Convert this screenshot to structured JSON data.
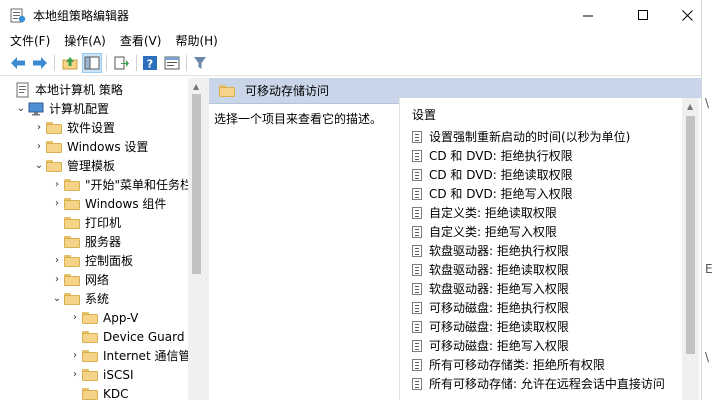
{
  "window": {
    "title": "本地组策略编辑器",
    "app_icon": "policy-editor-icon"
  },
  "menu": [
    {
      "label": "文件(F)"
    },
    {
      "label": "操作(A)"
    },
    {
      "label": "查看(V)"
    },
    {
      "label": "帮助(H)"
    }
  ],
  "toolbar": {
    "icons": [
      "back-icon",
      "forward-icon",
      "up-folder-icon",
      "show-hide-tree-icon",
      "export-list-icon",
      "help-icon",
      "properties-icon",
      "filter-icon"
    ]
  },
  "tree": [
    {
      "label": "本地计算机 策略",
      "indent": 0,
      "expander": "",
      "icon": "computer-policy-icon"
    },
    {
      "label": "计算机配置",
      "indent": 1,
      "expander": "expanded",
      "icon": "computer-icon"
    },
    {
      "label": "软件设置",
      "indent": 2,
      "expander": "collapsed",
      "icon": "folder-icon"
    },
    {
      "label": "Windows 设置",
      "indent": 2,
      "expander": "collapsed",
      "icon": "folder-icon"
    },
    {
      "label": "管理模板",
      "indent": 2,
      "expander": "expanded",
      "icon": "folder-icon"
    },
    {
      "label": "\"开始\"菜单和任务栏",
      "indent": 3,
      "expander": "collapsed",
      "icon": "folder-icon"
    },
    {
      "label": "Windows 组件",
      "indent": 3,
      "expander": "collapsed",
      "icon": "folder-icon"
    },
    {
      "label": "打印机",
      "indent": 3,
      "expander": "",
      "icon": "folder-icon"
    },
    {
      "label": "服务器",
      "indent": 3,
      "expander": "",
      "icon": "folder-icon"
    },
    {
      "label": "控制面板",
      "indent": 3,
      "expander": "collapsed",
      "icon": "folder-icon"
    },
    {
      "label": "网络",
      "indent": 3,
      "expander": "collapsed",
      "icon": "folder-icon"
    },
    {
      "label": "系统",
      "indent": 3,
      "expander": "expanded",
      "icon": "folder-icon"
    },
    {
      "label": "App-V",
      "indent": 4,
      "expander": "collapsed",
      "icon": "folder-icon"
    },
    {
      "label": "Device Guard",
      "indent": 4,
      "expander": "",
      "icon": "folder-icon"
    },
    {
      "label": "Internet 通信管理",
      "indent": 4,
      "expander": "collapsed",
      "icon": "folder-icon"
    },
    {
      "label": "iSCSI",
      "indent": 4,
      "expander": "collapsed",
      "icon": "folder-icon"
    },
    {
      "label": "KDC",
      "indent": 4,
      "expander": "",
      "icon": "folder-icon"
    }
  ],
  "details": {
    "header": "可移动存储访问",
    "description": "选择一个项目来查看它的描述。",
    "column_header": "设置",
    "settings": [
      "设置强制重新启动的时间(以秒为单位)",
      "CD 和 DVD: 拒绝执行权限",
      "CD 和 DVD: 拒绝读取权限",
      "CD 和 DVD: 拒绝写入权限",
      "自定义类: 拒绝读取权限",
      "自定义类: 拒绝写入权限",
      "软盘驱动器: 拒绝执行权限",
      "软盘驱动器: 拒绝读取权限",
      "软盘驱动器: 拒绝写入权限",
      "可移动磁盘: 拒绝执行权限",
      "可移动磁盘: 拒绝读取权限",
      "可移动磁盘: 拒绝写入权限",
      "所有可移动存储类: 拒绝所有权限",
      "所有可移动存储: 允许在远程会话中直接访问"
    ]
  },
  "edge_glyphs": [
    "\\",
    "E",
    "\\"
  ],
  "colors": {
    "header_bar": "#c9d6e9",
    "folder": "#f5d489",
    "toolbar_pressed": "#cce4f7"
  }
}
